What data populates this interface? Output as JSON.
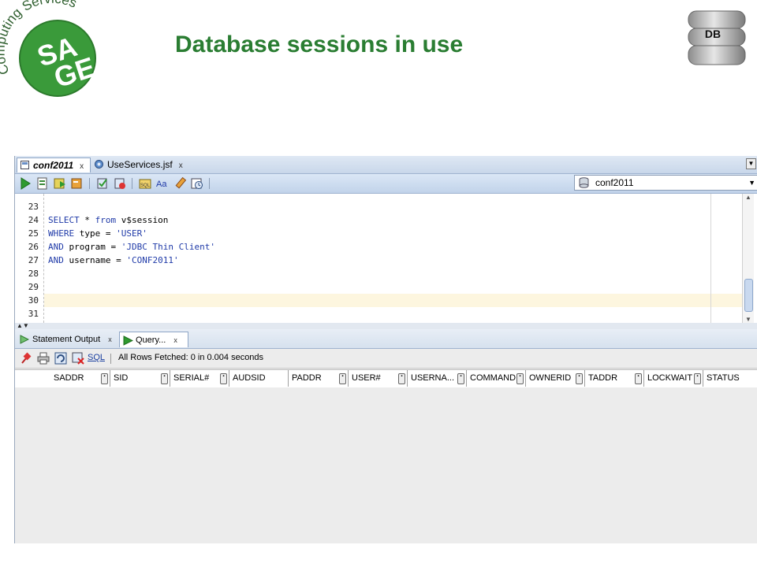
{
  "slide": {
    "title": "Database sessions in use",
    "logo_text": "Computing Services",
    "logo_letters": "SAGE",
    "db_label": "DB"
  },
  "colors": {
    "title_green": "#2a7d32",
    "logo_green": "#3a9a3a",
    "keyword_blue": "#1f3aa8",
    "highlight_line": "#fdf6df"
  },
  "ide": {
    "tabs": [
      {
        "label": "conf2011",
        "close": "x",
        "icon": "sql-worksheet-icon",
        "active": true
      },
      {
        "label": "UseServices.jsf",
        "close": "x",
        "icon": "jsf-file-icon",
        "active": false
      }
    ],
    "toolbar_icons": [
      "run-statement-icon",
      "run-script-icon",
      "autotrace-icon",
      "explain-plan-icon",
      "commit-icon",
      "rollback-icon",
      "sql-tuning-icon",
      "to-upper-icon",
      "clear-icon",
      "history-icon"
    ],
    "connection": "conf2011",
    "editor": {
      "lines": [
        {
          "num": "23",
          "code": ""
        },
        {
          "num": "24",
          "code": "SELECT * from v$session"
        },
        {
          "num": "25",
          "code": "WHERE type = 'USER'"
        },
        {
          "num": "26",
          "code": "AND program = 'JDBC Thin Client'"
        },
        {
          "num": "27",
          "code": "AND username = 'CONF2011'"
        },
        {
          "num": "28",
          "code": ""
        },
        {
          "num": "29",
          "code": ""
        },
        {
          "num": "30",
          "code": ""
        },
        {
          "num": "31",
          "code": ""
        }
      ],
      "line24": {
        "kw1": "SELECT",
        "mid": " * ",
        "kw2": "from",
        "ident": " v$session"
      },
      "line25": {
        "kw": "WHERE",
        "ident": " type = ",
        "str": "'USER'"
      },
      "line26": {
        "kw": "AND",
        "ident": " program = ",
        "str": "'JDBC Thin Client'"
      },
      "line27": {
        "kw": "AND",
        "ident": " username = ",
        "str": "'CONF2011'"
      }
    },
    "result_tabs": [
      {
        "label": "Statement Output",
        "close": "x",
        "active": false
      },
      {
        "label": "Query...",
        "close": "x",
        "active": true
      }
    ],
    "results": {
      "sql_link": "SQL",
      "status": "All Rows Fetched: 0 in 0.004 seconds",
      "columns": [
        "SADDR",
        "SID",
        "SERIAL#",
        "AUDSID",
        "PADDR",
        "USER#",
        "USERNA...",
        "COMMAND",
        "OWNERID",
        "TADDR",
        "LOCKWAIT",
        "STATUS"
      ]
    }
  }
}
